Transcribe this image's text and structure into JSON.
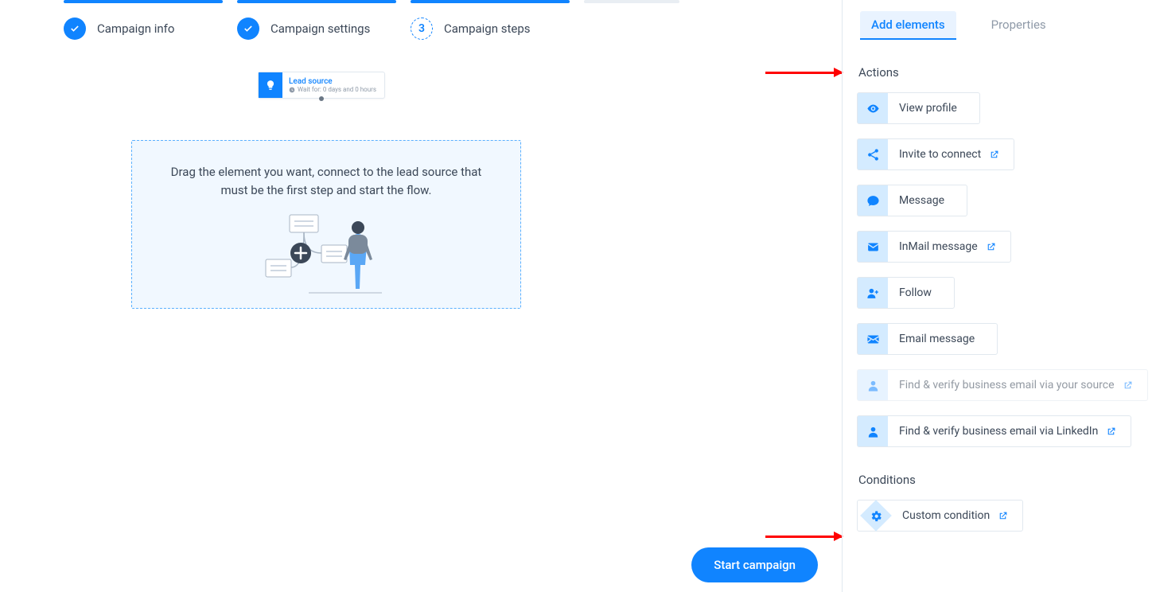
{
  "stepper": {
    "steps": [
      {
        "label": "Campaign info",
        "state": "done"
      },
      {
        "label": "Campaign settings",
        "state": "done"
      },
      {
        "label": "Campaign steps",
        "state": "active",
        "number": "3"
      }
    ]
  },
  "leadSource": {
    "title": "Lead source",
    "subtitle": "Wait for: 0 days and 0 hours"
  },
  "dropZone": {
    "text": "Drag the element you want, connect to the lead source that must be the first step and start the flow."
  },
  "startButton": {
    "label": "Start campaign"
  },
  "side": {
    "tabs": {
      "active": "Add elements",
      "inactive": "Properties"
    },
    "sections": {
      "actions": {
        "heading": "Actions",
        "items": [
          {
            "label": "View profile",
            "icon": "eye-icon",
            "hasExternal": false,
            "disabled": false
          },
          {
            "label": "Invite to connect",
            "icon": "share-icon",
            "hasExternal": true,
            "disabled": false
          },
          {
            "label": "Message",
            "icon": "chat-icon",
            "hasExternal": false,
            "disabled": false
          },
          {
            "label": "InMail message",
            "icon": "inmail-icon",
            "hasExternal": true,
            "disabled": false
          },
          {
            "label": "Follow",
            "icon": "follow-icon",
            "hasExternal": false,
            "disabled": false
          },
          {
            "label": "Email message",
            "icon": "email-icon",
            "hasExternal": false,
            "disabled": false
          },
          {
            "label": "Find & verify business email via your source",
            "icon": "person-icon",
            "hasExternal": true,
            "disabled": true
          },
          {
            "label": "Find & verify business email via LinkedIn",
            "icon": "person-icon",
            "hasExternal": true,
            "disabled": false
          }
        ]
      },
      "conditions": {
        "heading": "Conditions",
        "items": [
          {
            "label": "Custom condition",
            "icon": "gears-icon",
            "hasExternal": true,
            "disabled": false
          }
        ]
      }
    }
  },
  "colors": {
    "accent": "#1084ff",
    "accentLight": "#d4ebff"
  }
}
